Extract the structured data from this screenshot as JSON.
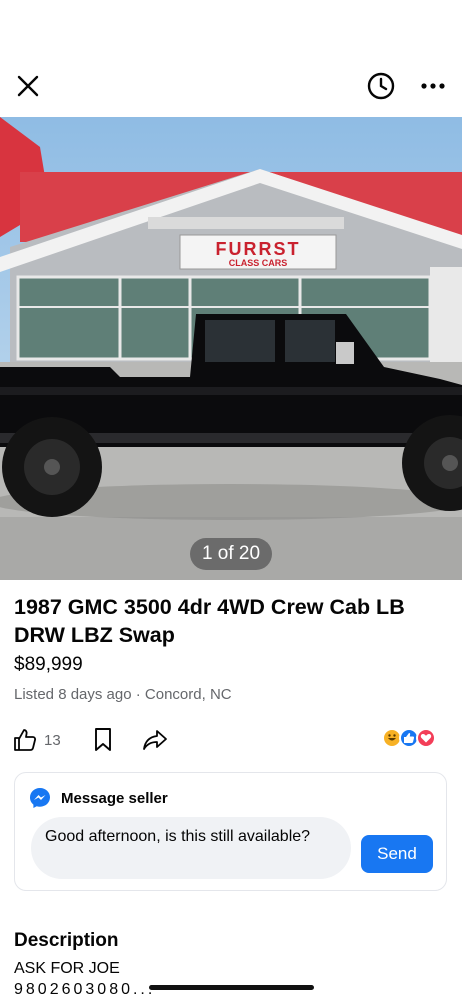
{
  "header": {
    "close_icon": "close-icon",
    "history_icon": "clock-icon",
    "more_icon": "more-dots-icon"
  },
  "photo": {
    "sign_line1": "FURRST",
    "sign_line2": "CLASS CARS",
    "counter": "1 of 20"
  },
  "listing": {
    "title": "1987 GMC 3500 4dr 4WD Crew Cab LB DRW LBZ Swap",
    "price": "$89,999",
    "listed": "Listed 8 days ago · Concord, NC"
  },
  "actions": {
    "like_count": "13",
    "reactions": [
      "haha",
      "like",
      "love"
    ]
  },
  "message": {
    "header": "Message seller",
    "input_value": "Good afternoon, is this still available?",
    "send_label": "Send"
  },
  "description": {
    "heading": "Description",
    "line1": "ASK FOR JOE",
    "line2": "9802603080..."
  },
  "colors": {
    "accent": "#1877f2",
    "secondary_text": "#65676b",
    "input_bg": "#f0f2f5"
  }
}
